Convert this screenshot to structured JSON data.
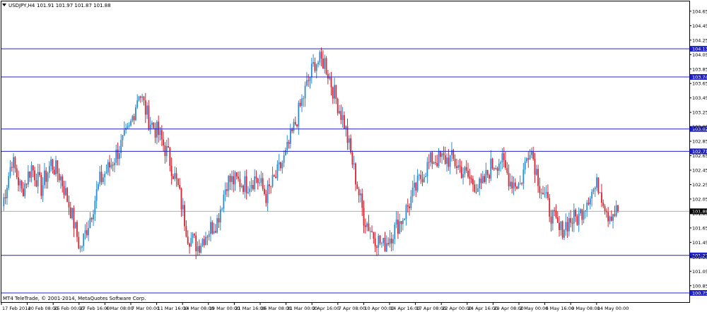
{
  "header": {
    "symbol_label": "USDJPY,H4",
    "ohlc": "101.91 101.97 101.87 101.88",
    "dropdown_icon": "triangle-down-icon"
  },
  "footer": {
    "copyright": "MT4 TeleTrade, © 2001-2014, MetaQuotes Software Corp."
  },
  "colors": {
    "bull": "#2a8ad8",
    "bear": "#e0202c",
    "level_line": "#2020c8",
    "level_label_bg": "#2020c8",
    "price_label_bg": "#000000",
    "grid_line": "#b0b0b0"
  },
  "chart_data": {
    "type": "candlestick",
    "symbol": "USDJPY",
    "timeframe": "H4",
    "ylim": [
      100.75,
      104.6
    ],
    "y_ticks": [
      "104.65",
      "104.45",
      "104.25",
      "104.05",
      "103.85",
      "103.65",
      "103.45",
      "103.25",
      "103.05",
      "102.85",
      "102.65",
      "102.45",
      "102.25",
      "102.05",
      "101.85",
      "101.65",
      "101.45",
      "101.25",
      "101.05",
      "100.85"
    ],
    "x_ticks": [
      "17 Feb 2014",
      "20 Feb 08:00",
      "25 Feb 00:00",
      "27 Feb 16:00",
      "4 Mar 08:00",
      "7 Mar 00:00",
      "11 Mar 16:00",
      "14 Mar 08:00",
      "19 Mar 00:00",
      "21 Mar 16:00",
      "26 Mar 08:00",
      "31 Mar 00:00",
      "2 Apr 16:00",
      "7 Apr 08:00",
      "10 Apr 00:00",
      "14 Apr 16:00",
      "17 Apr 08:00",
      "22 Apr 00:00",
      "24 Apr 16:00",
      "29 Apr 08:00",
      "2 May 00:00",
      "6 May 16:00",
      "9 May 08:00",
      "14 May 00:00"
    ],
    "horizontal_levels": [
      "104.13",
      "103.74",
      "103.02",
      "102.71",
      "101.27",
      "100.75"
    ],
    "current_price": "101.88",
    "series": [
      {
        "name": "",
        "points": [
          [
            "17 Feb 2014",
            101.95
          ],
          [
            "18 Feb",
            102.6
          ],
          [
            "19 Feb",
            102.15
          ],
          [
            "20 Feb 08:00",
            102.5
          ],
          [
            "21 Feb",
            102.2
          ],
          [
            "24 Feb",
            102.55
          ],
          [
            "25 Feb 00:00",
            102.35
          ],
          [
            "26 Feb",
            101.9
          ],
          [
            "27 Feb 16:00",
            101.35
          ],
          [
            "28 Feb",
            101.8
          ],
          [
            "3 Mar",
            102.3
          ],
          [
            "4 Mar 08:00",
            102.5
          ],
          [
            "5 Mar",
            102.75
          ],
          [
            "6 Mar",
            103.0
          ],
          [
            "7 Mar 00:00",
            103.55
          ],
          [
            "10 Mar",
            103.15
          ],
          [
            "11 Mar 16:00",
            102.95
          ],
          [
            "12 Mar",
            102.65
          ],
          [
            "13 Mar",
            102.2
          ],
          [
            "14 Mar 08:00",
            101.55
          ],
          [
            "17 Mar",
            101.4
          ],
          [
            "18 Mar",
            101.6
          ],
          [
            "19 Mar 00:00",
            101.75
          ],
          [
            "20 Mar",
            102.3
          ],
          [
            "21 Mar 16:00",
            102.3
          ],
          [
            "24 Mar",
            102.25
          ],
          [
            "25 Mar",
            102.35
          ],
          [
            "26 Mar 08:00",
            102.1
          ],
          [
            "27 Mar",
            102.35
          ],
          [
            "28 Mar",
            102.65
          ],
          [
            "31 Mar 00:00",
            103.1
          ],
          [
            "1 Apr",
            103.55
          ],
          [
            "2 Apr 16:00",
            103.95
          ],
          [
            "3 Apr",
            103.95
          ],
          [
            "4 Apr",
            103.5
          ],
          [
            "7 Apr 08:00",
            103.1
          ],
          [
            "8 Apr",
            102.45
          ],
          [
            "9 Apr",
            101.8
          ],
          [
            "10 Apr 00:00",
            101.55
          ],
          [
            "11 Apr",
            101.4
          ],
          [
            "14 Apr 16:00",
            101.6
          ],
          [
            "15 Apr",
            101.8
          ],
          [
            "16 Apr",
            102.1
          ],
          [
            "17 Apr 08:00",
            102.4
          ],
          [
            "18 Apr",
            102.6
          ],
          [
            "21 Apr",
            102.6
          ],
          [
            "22 Apr 00:00",
            102.6
          ],
          [
            "23 Apr",
            102.45
          ],
          [
            "24 Apr 16:00",
            102.3
          ],
          [
            "25 Apr",
            102.2
          ],
          [
            "28 Apr",
            102.5
          ],
          [
            "29 Apr 08:00",
            102.6
          ],
          [
            "30 Apr",
            102.3
          ],
          [
            "1 May",
            102.25
          ],
          [
            "2 May 00:00",
            102.8
          ],
          [
            "5 May",
            102.25
          ],
          [
            "6 May 16:00",
            101.9
          ],
          [
            "7 May",
            101.6
          ],
          [
            "8 May",
            101.75
          ],
          [
            "9 May 08:00",
            101.8
          ],
          [
            "12 May",
            102.1
          ],
          [
            "13 May",
            102.25
          ],
          [
            "14 May 00:00",
            101.85
          ],
          [
            "15 May",
            101.88
          ]
        ]
      }
    ]
  }
}
